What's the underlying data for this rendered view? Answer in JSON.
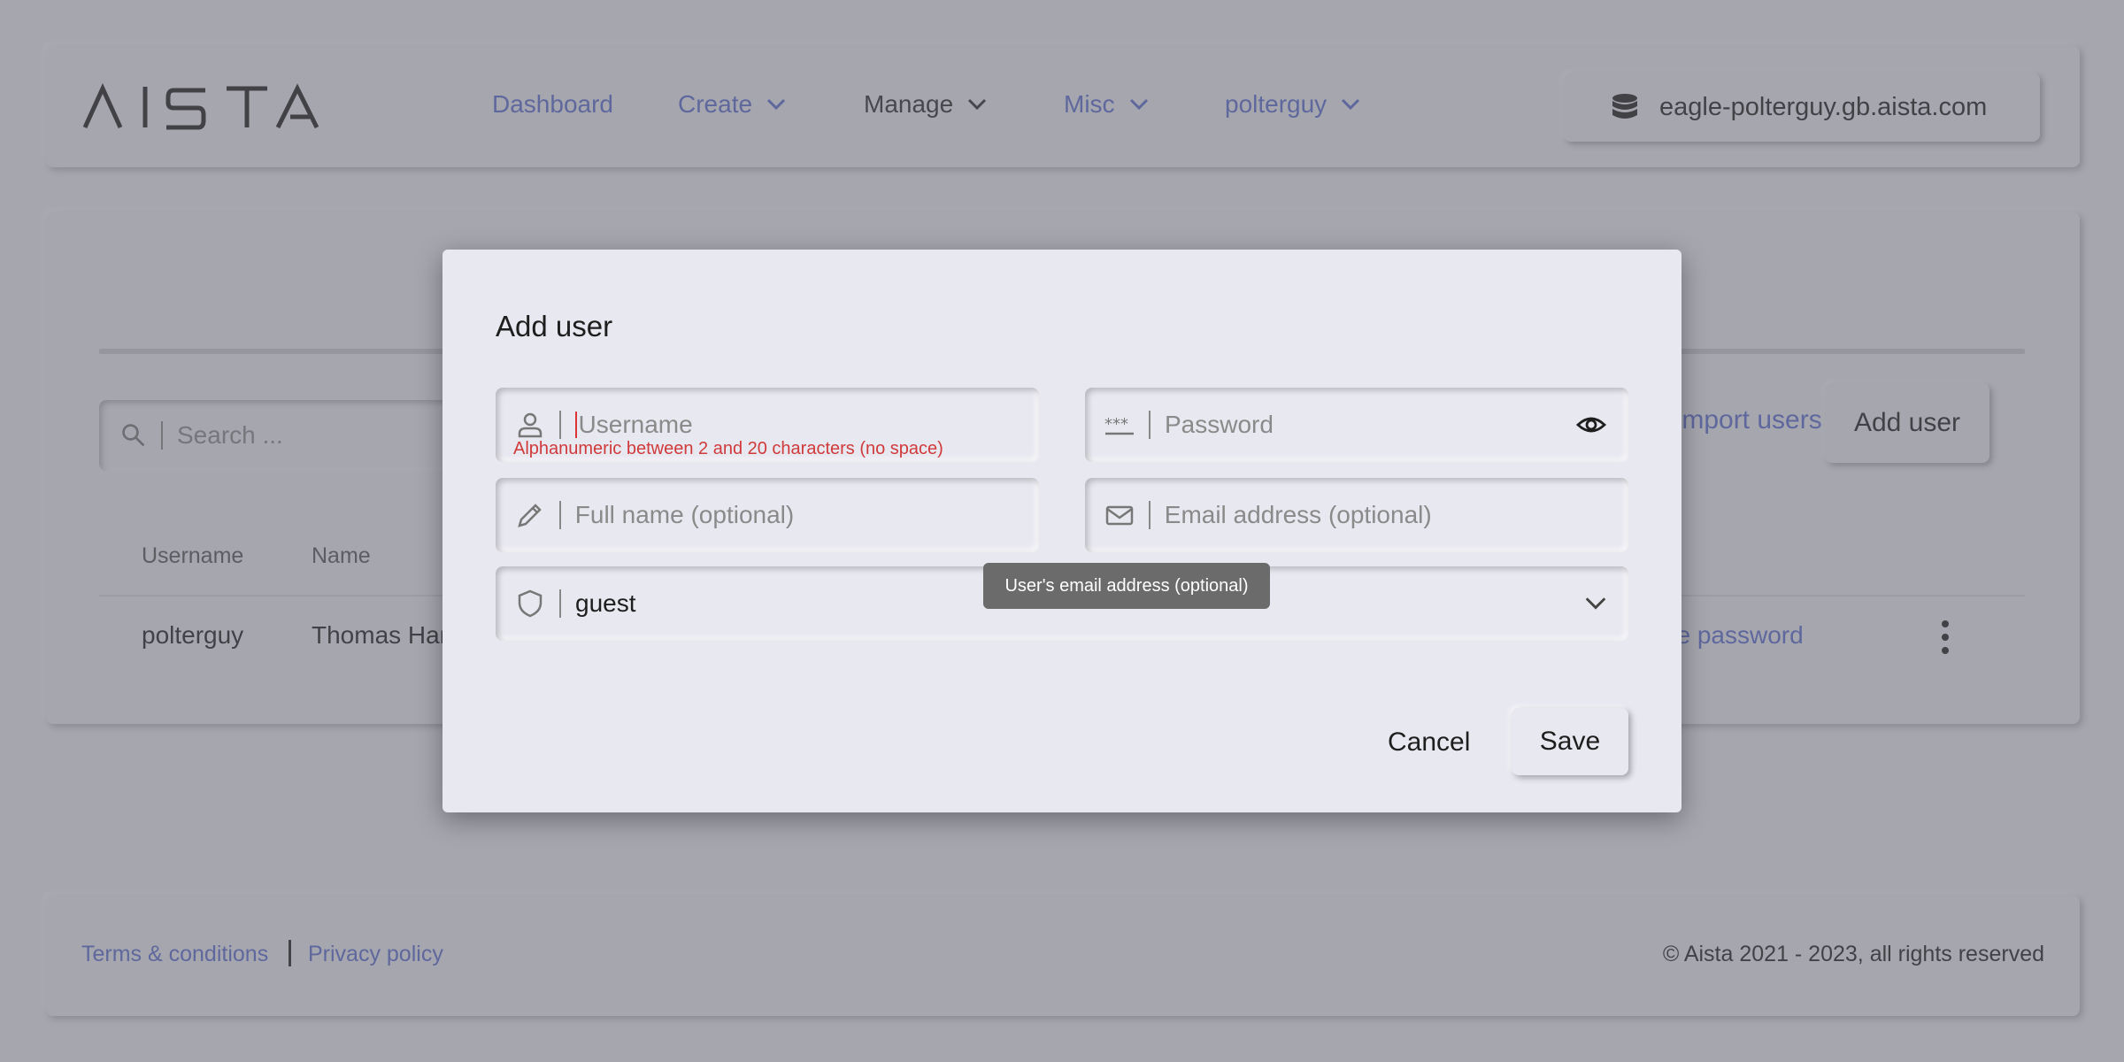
{
  "header": {
    "logo_text": "AISTA",
    "nav": [
      {
        "label": "Dashboard",
        "dropdown": false,
        "active": false
      },
      {
        "label": "Create",
        "dropdown": true,
        "active": false
      },
      {
        "label": "Manage",
        "dropdown": true,
        "active": true
      },
      {
        "label": "Misc",
        "dropdown": true,
        "active": false
      },
      {
        "label": "polterguy",
        "dropdown": true,
        "active": false
      }
    ],
    "server": {
      "icon": "database-icon",
      "label": "eagle-polterguy.gb.aista.com"
    }
  },
  "main": {
    "search_placeholder": "Search ...",
    "import_link": "Import users",
    "add_user_label": "Add user",
    "columns": [
      "Username",
      "Name"
    ],
    "rows": [
      {
        "username": "polterguy",
        "name": "Thomas Hansen",
        "action": "Change password"
      }
    ]
  },
  "dialog": {
    "title": "Add user",
    "username_placeholder": "Username",
    "username_error": "Alphanumeric between 2 and 20 characters (no space)",
    "password_placeholder": "Password",
    "fullname_placeholder": "Full name (optional)",
    "email_placeholder": "Email address (optional)",
    "role_value": "guest",
    "tooltip": "User's email address (optional)",
    "cancel_label": "Cancel",
    "save_label": "Save"
  },
  "footer": {
    "terms": "Terms & conditions",
    "privacy": "Privacy policy",
    "copyright": "© Aista 2021 - 2023, all rights reserved"
  },
  "colors": {
    "accent": "#5b6ccc",
    "background": "#e8e8f0",
    "error": "#d03a3a"
  }
}
